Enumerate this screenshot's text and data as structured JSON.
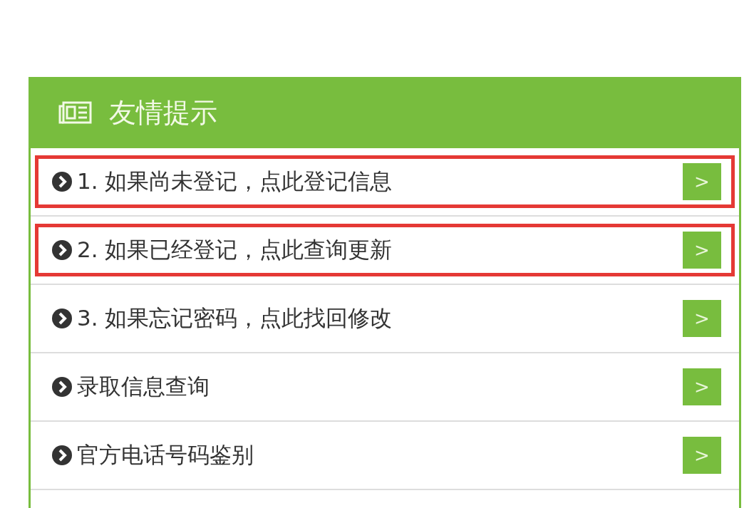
{
  "panel": {
    "title": "友情提示",
    "items": [
      {
        "label": "1. 如果尚未登记，点此登记信息",
        "highlighted": true,
        "button": ">"
      },
      {
        "label": "2. 如果已经登记，点此查询更新",
        "highlighted": true,
        "button": ">"
      },
      {
        "label": "3. 如果忘记密码，点此找回修改",
        "highlighted": false,
        "button": ">"
      },
      {
        "label": "录取信息查询",
        "highlighted": false,
        "button": ">"
      },
      {
        "label": "官方电话号码鉴别",
        "highlighted": false,
        "button": ">"
      }
    ]
  }
}
